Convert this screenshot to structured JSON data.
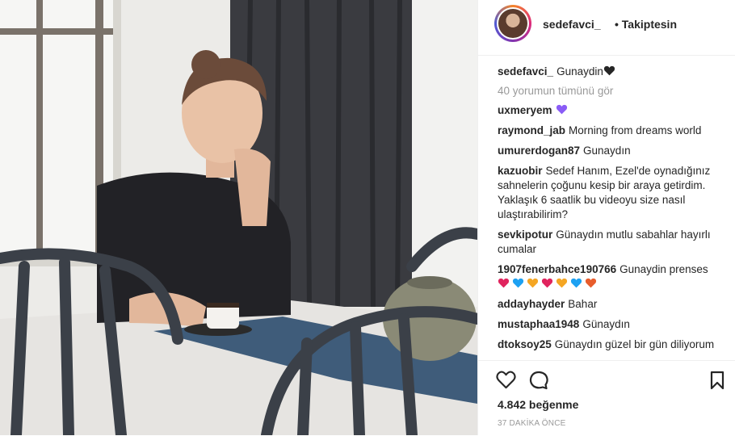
{
  "header": {
    "username": "sedefavci_",
    "follow_label": "• Takiptesin"
  },
  "caption": {
    "username": "sedefavci_",
    "text": "Gunaydin"
  },
  "view_all": "40 yorumun tümünü gör",
  "comments": [
    {
      "user": "uxmeryem",
      "text": ""
    },
    {
      "user": "raymond_jab",
      "text": "Morning from dreams world"
    },
    {
      "user": "umurerdogan87",
      "text": "Gunaydın"
    },
    {
      "user": "kazuobir",
      "text": "Sedef Hanım, Ezel'de oynadığınız sahnelerin çoğunu kesip bir araya getirdim. Yaklaşık 6 saatlik bu videoyu size nasıl ulaştırabilirim?"
    },
    {
      "user": "sevkipotur",
      "text": "Günaydın mutlu sabahlar hayırlı cumalar"
    },
    {
      "user": "1907fenerbahce190766",
      "text": "Gunaydin prenses"
    },
    {
      "user": "addayhayder",
      "text": "Bahar"
    },
    {
      "user": "mustaphaa1948",
      "text": "Günaydın"
    },
    {
      "user": "dtoksoy25",
      "text": "Günaydın güzel bir gün diliyorum"
    }
  ],
  "heart_colors": [
    "#e0245e",
    "#1da1f2",
    "#f5a623",
    "#e0245e",
    "#f5a623",
    "#1da1f2",
    "#e85d2c"
  ],
  "likes": "4.842 beğenme",
  "time": "37 DAKİKA ÖNCE",
  "icons": [
    "heart-icon",
    "comment-icon",
    "bookmark-icon"
  ]
}
